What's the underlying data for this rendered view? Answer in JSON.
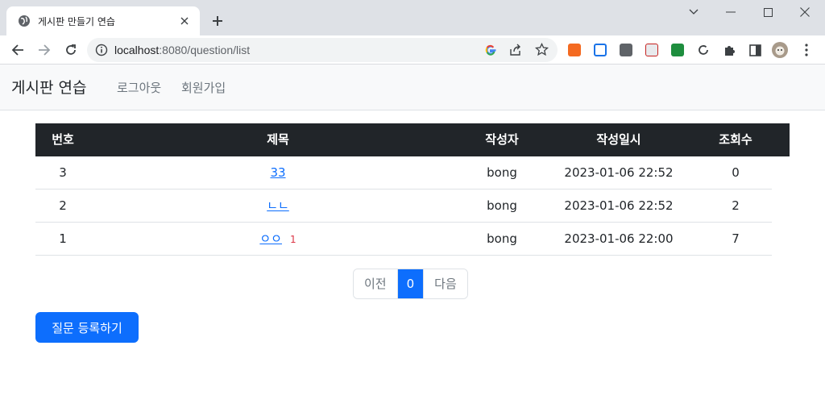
{
  "browser": {
    "tab_title": "게시판 만들기 연습",
    "url_host": "localhost",
    "url_rest": ":8080/question/list"
  },
  "navbar": {
    "brand": "게시판 연습",
    "links": [
      "로그아웃",
      "회원가입"
    ]
  },
  "table": {
    "headers": [
      "번호",
      "제목",
      "작성자",
      "작성일시",
      "조회수"
    ],
    "rows": [
      {
        "no": "3",
        "title": "33",
        "comments": "",
        "author": "bong",
        "date": "2023-01-06 22:52",
        "views": "0"
      },
      {
        "no": "2",
        "title": "ㄴㄴ",
        "comments": "",
        "author": "bong",
        "date": "2023-01-06 22:52",
        "views": "2"
      },
      {
        "no": "1",
        "title": "ㅇㅇ",
        "comments": "1",
        "author": "bong",
        "date": "2023-01-06 22:00",
        "views": "7"
      }
    ]
  },
  "pagination": {
    "prev": "이전",
    "current": "0",
    "next": "다음"
  },
  "actions": {
    "create": "질문 등록하기"
  },
  "colors": {
    "primary": "#0d6efd",
    "header_bg": "#212529",
    "comment_badge": "#dc3545"
  }
}
